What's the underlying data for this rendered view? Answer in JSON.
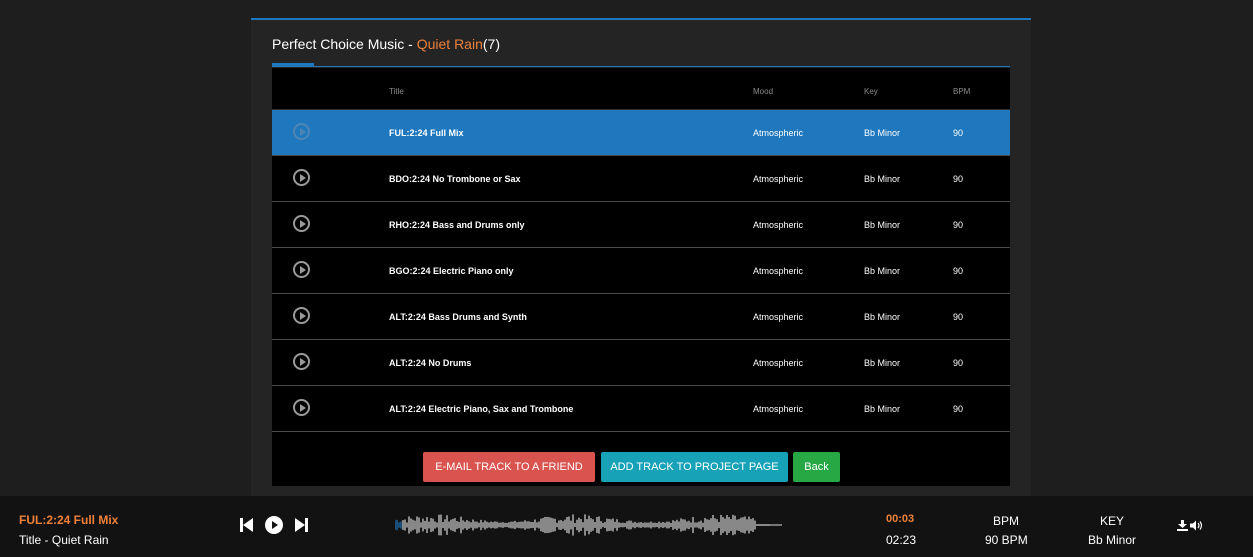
{
  "panel": {
    "title_prefix": "Perfect Choice Music - ",
    "title_album": "Quiet Rain",
    "title_count": "(7)"
  },
  "table": {
    "headers": {
      "title": "Title",
      "mood": "Mood",
      "key": "Key",
      "bpm": "BPM"
    },
    "rows": [
      {
        "title": "FUL:2:24 Full Mix",
        "mood": "Atmospheric",
        "key": "Bb Minor",
        "bpm": "90",
        "selected": true
      },
      {
        "title": "BDO:2:24 No Trombone or Sax",
        "mood": "Atmospheric",
        "key": "Bb Minor",
        "bpm": "90",
        "selected": false
      },
      {
        "title": "RHO:2:24 Bass and Drums only",
        "mood": "Atmospheric",
        "key": "Bb Minor",
        "bpm": "90",
        "selected": false
      },
      {
        "title": "BGO:2:24 Electric Piano only",
        "mood": "Atmospheric",
        "key": "Bb Minor",
        "bpm": "90",
        "selected": false
      },
      {
        "title": "ALT:2:24 Bass Drums and Synth",
        "mood": "Atmospheric",
        "key": "Bb Minor",
        "bpm": "90",
        "selected": false
      },
      {
        "title": "ALT:2:24 No Drums",
        "mood": "Atmospheric",
        "key": "Bb Minor",
        "bpm": "90",
        "selected": false
      },
      {
        "title": "ALT:2:24 Electric Piano, Sax and Trombone",
        "mood": "Atmospheric",
        "key": "Bb Minor",
        "bpm": "90",
        "selected": false
      }
    ]
  },
  "actions": {
    "email_label": "E-MAIL TRACK TO A FRIEND",
    "add_label": "ADD TRACK TO PROJECT PAGE",
    "back_label": "Back"
  },
  "player": {
    "track_title": "FUL:2:24 Full Mix",
    "subtitle": "Title - Quiet Rain",
    "current_time": "00:03",
    "total_time": "02:23",
    "bpm_label": "BPM",
    "bpm_value": "90 BPM",
    "key_label": "KEY",
    "key_value": "Bb Minor",
    "progress": 0.02
  },
  "colors": {
    "accent_orange": "#f0813a",
    "selected_blue": "#1f77bd",
    "email_red": "#d9534f",
    "add_teal": "#17a2b8",
    "back_green": "#28a745"
  },
  "icons": [
    "play-circle-icon",
    "previous-icon",
    "play-icon",
    "next-icon",
    "download-icon",
    "volume-icon"
  ]
}
